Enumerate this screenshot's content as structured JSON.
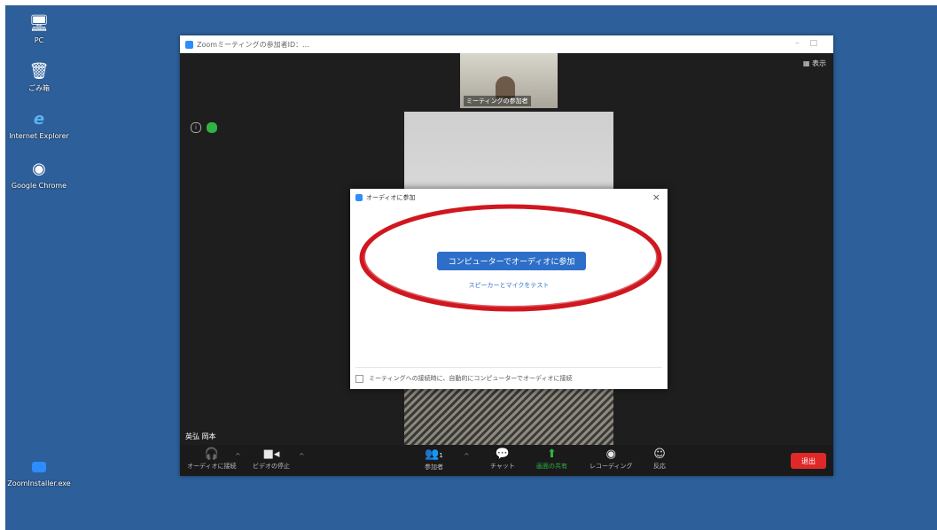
{
  "desktop": {
    "icons": [
      {
        "name": "PC",
        "label": "PC"
      },
      {
        "name": "recycle-bin",
        "label": "ごみ箱"
      },
      {
        "name": "internet-explorer",
        "label": "Internet Explorer"
      },
      {
        "name": "google-chrome",
        "label": "Google Chrome"
      },
      {
        "name": "zoom-shortcut",
        "label": "ZoomInstaller.exe"
      }
    ]
  },
  "zoom": {
    "title": "Zoomミーティングの参加者ID：...",
    "view_toggle": "表示",
    "thumbnail_caption": "ミーティングの参加者",
    "participant_name": "英弘 岡本"
  },
  "dialog": {
    "title": "オーディオに参加",
    "join_button": "コンピューターでオーディオに参加",
    "test_link": "スピーカーとマイクをテスト",
    "auto_join_label": "ミーティングへの接続時に、自動的にコンピューターでオーディオに接続"
  },
  "toolbar": {
    "audio": "オーディオに接続",
    "video": "ビデオの停止",
    "participants": "参加者",
    "participants_count": "1",
    "chat": "チャット",
    "share": "画面の共有",
    "record": "レコーディング",
    "reactions": "反応",
    "end": "退出"
  },
  "colors": {
    "desktop": "#2d5f9a",
    "zoom_blue": "#2d6fc8",
    "end_red": "#e02828",
    "annotation_red": "#d0171f"
  }
}
